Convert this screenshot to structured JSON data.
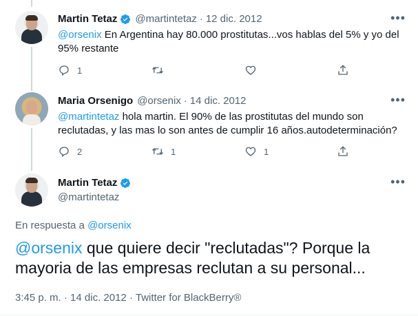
{
  "tweets": [
    {
      "name": "Martin Tetaz",
      "handle": "@martintetaz",
      "date": "12 dic. 2012",
      "mention": "@orsenix",
      "text": " En Argentina hay 80.000 prostitutas...vos hablas del 5% y yo del 95% restante",
      "reply_count": "1",
      "retweet_count": "",
      "like_count": ""
    },
    {
      "name": "Maria Orsenigo",
      "handle": "@orsenix",
      "date": "14 dic. 2012",
      "mention": "@martintetaz",
      "text": " hola martin. El 90% de las prostitutas del mundo son reclutadas, y las mas lo son  antes de cumplir 16 años.autodeterminación?",
      "reply_count": "2",
      "retweet_count": "1",
      "like_count": "1"
    }
  ],
  "main_tweet": {
    "name": "Martin Tetaz",
    "handle": "@martintetaz",
    "reply_prefix": "En respuesta a ",
    "reply_mention": "@orsenix",
    "mention": "@orsenix",
    "text": " que quiere decir \"reclutadas\"? Porque la mayoria de las empresas reclutan a su personal...",
    "time": "3:45 p. m.",
    "date": "14 dic. 2012",
    "source": "Twitter for BlackBerry®"
  },
  "separator": "·",
  "more_glyph": "•••",
  "colors": {
    "accent": "#1d9bf0",
    "muted": "#536471",
    "text": "#0f1419"
  },
  "icons": [
    "verified-badge-icon",
    "reply-icon",
    "retweet-icon",
    "like-icon",
    "share-icon",
    "more-icon"
  ]
}
